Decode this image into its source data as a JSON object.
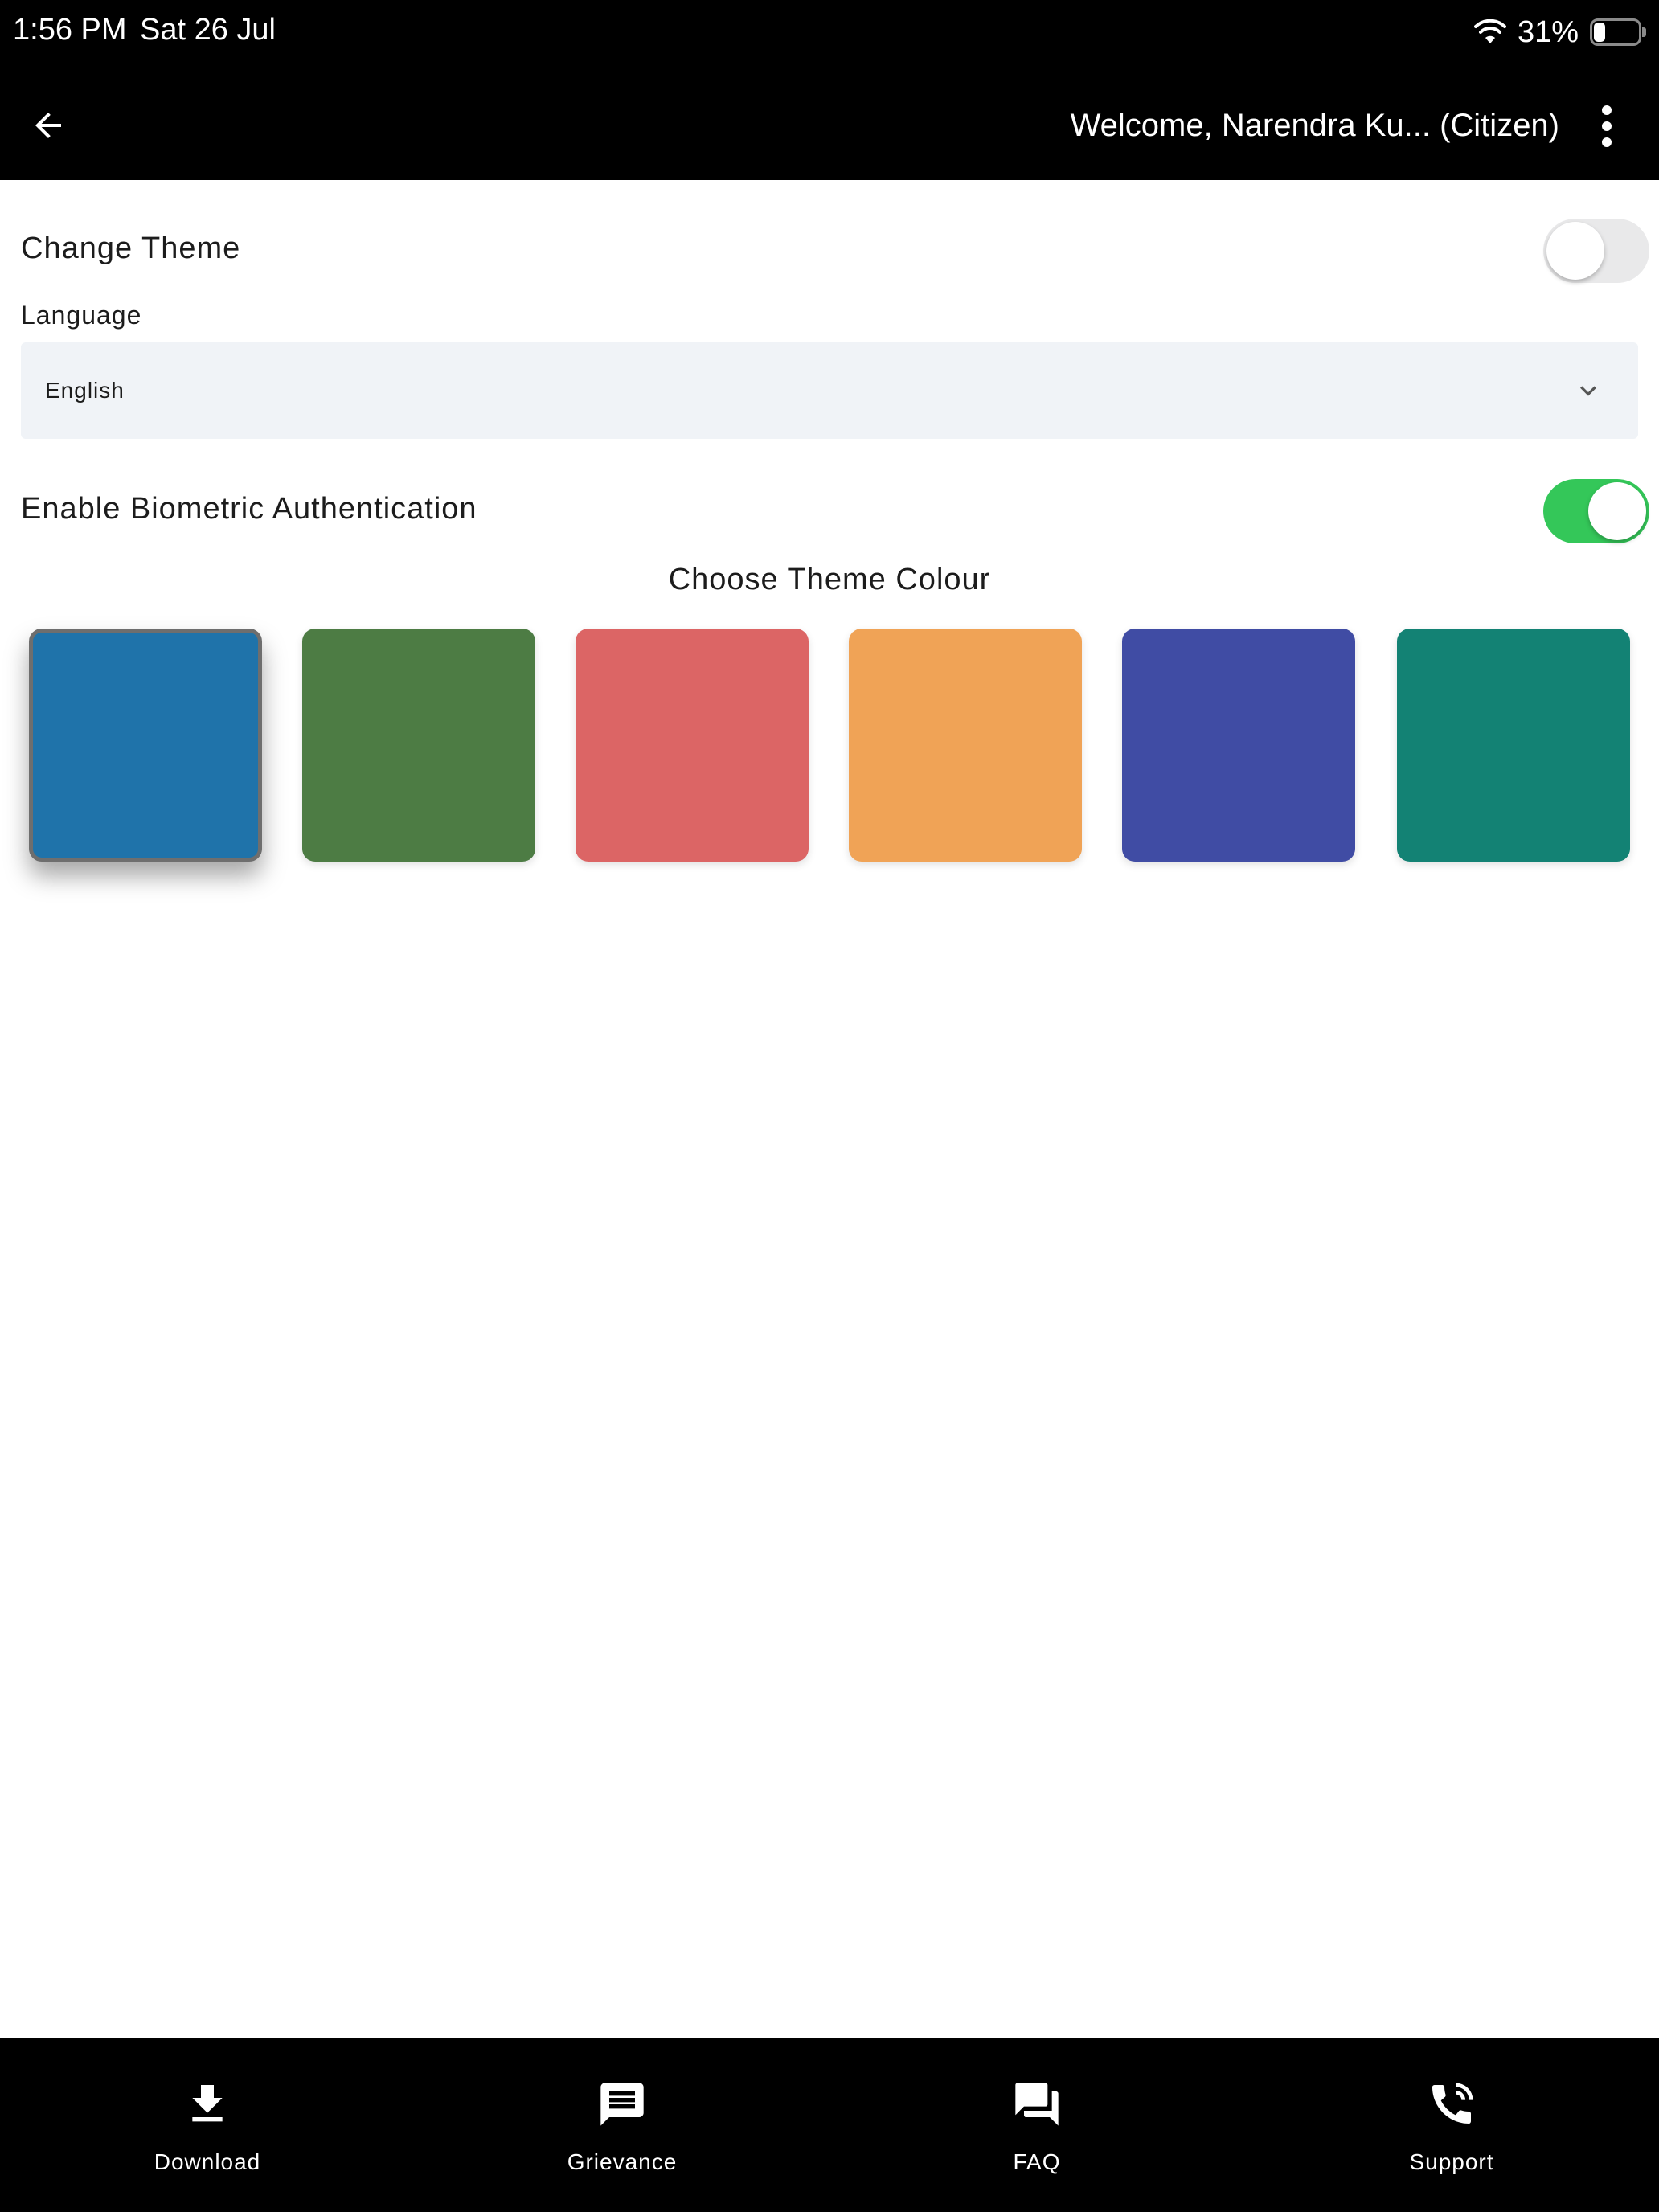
{
  "status_bar": {
    "time": "1:56 PM",
    "date": "Sat 26 Jul",
    "battery": "31%",
    "battery_level": 0.31
  },
  "app_bar": {
    "back_icon": "arrow-left-icon",
    "welcome": "Welcome, Narendra Ku... (Citizen)",
    "more_icon": "more-vert-icon"
  },
  "settings": {
    "change_theme": {
      "label": "Change Theme",
      "enabled": false
    },
    "language": {
      "label": "Language",
      "value": "English"
    },
    "biometric": {
      "label": "Enable Biometric Authentication",
      "enabled": true
    }
  },
  "theme": {
    "heading": "Choose Theme Colour",
    "selected_index": 0,
    "colors": [
      "#1f73aa",
      "#4d7c44",
      "#dc6565",
      "#f0a356",
      "#404ca4",
      "#138274"
    ]
  },
  "colors": {
    "toggle_on": "#34c759",
    "toggle_off": "#e9e9ea",
    "select_bg": "#f0f3f7"
  },
  "bottom_nav": [
    {
      "label": "Download",
      "icon": "download-icon"
    },
    {
      "label": "Grievance",
      "icon": "message-icon"
    },
    {
      "label": "FAQ",
      "icon": "forum-icon"
    },
    {
      "label": "Support",
      "icon": "phone-icon"
    }
  ]
}
